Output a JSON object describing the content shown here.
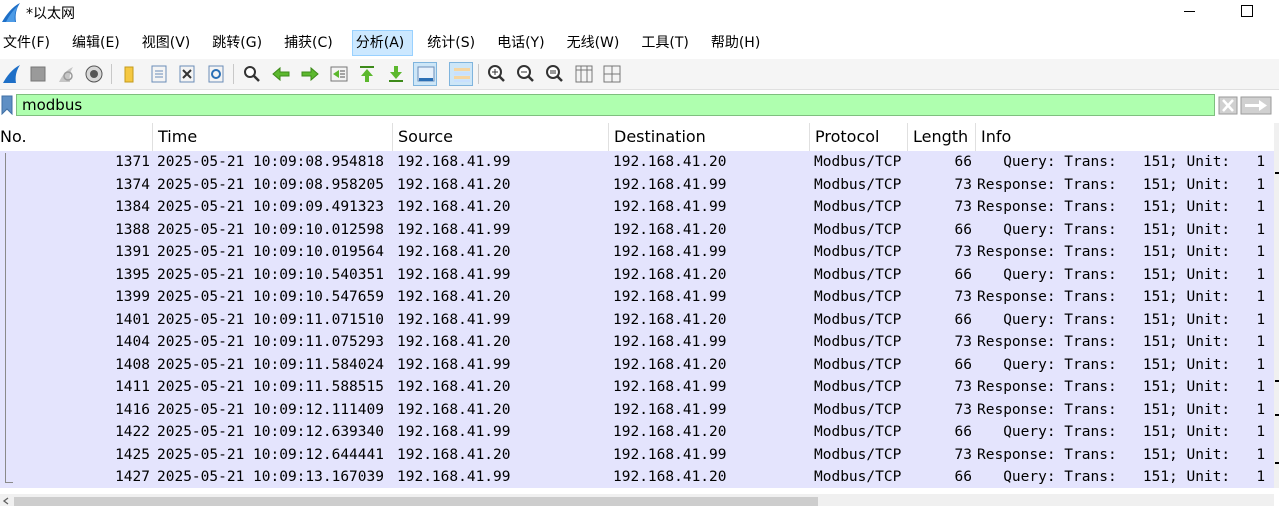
{
  "window": {
    "title": "*以太网"
  },
  "menu": [
    "文件(F)",
    "编辑(E)",
    "视图(V)",
    "跳转(G)",
    "捕获(C)",
    "分析(A)",
    "统计(S)",
    "电话(Y)",
    "无线(W)",
    "工具(T)",
    "帮助(H)"
  ],
  "menu_active_index": 5,
  "toolbar": {
    "icons": [
      "start-capture-icon",
      "stop-capture-icon",
      "restart-capture-icon",
      "capture-options-icon",
      "open-file-icon",
      "save-file-icon",
      "close-file-icon",
      "reload-file-icon",
      "find-packet-icon",
      "go-back-icon",
      "go-forward-icon",
      "go-to-packet-icon",
      "first-packet-icon",
      "last-packet-icon",
      "autoscroll-icon",
      "colorize-icon",
      "zoom-in-icon",
      "zoom-out-icon",
      "normal-size-icon",
      "resize-columns-icon",
      "layout-icon"
    ]
  },
  "filter": {
    "value": "modbus"
  },
  "columns": [
    "No.",
    "Time",
    "Source",
    "Destination",
    "Protocol",
    "Length",
    "Info"
  ],
  "packets": [
    {
      "no": "1371",
      "time": "2025-05-21 10:09:08.954818",
      "src": "192.168.41.99",
      "dst": "192.168.41.20",
      "proto": "Modbus/TCP",
      "len": "66",
      "info": "   Query: Trans:   151; Unit:   1"
    },
    {
      "no": "1374",
      "time": "2025-05-21 10:09:08.958205",
      "src": "192.168.41.20",
      "dst": "192.168.41.99",
      "proto": "Modbus/TCP",
      "len": "73",
      "info": "Response: Trans:   151; Unit:   1"
    },
    {
      "no": "1384",
      "time": "2025-05-21 10:09:09.491323",
      "src": "192.168.41.20",
      "dst": "192.168.41.99",
      "proto": "Modbus/TCP",
      "len": "73",
      "info": "Response: Trans:   151; Unit:   1"
    },
    {
      "no": "1388",
      "time": "2025-05-21 10:09:10.012598",
      "src": "192.168.41.99",
      "dst": "192.168.41.20",
      "proto": "Modbus/TCP",
      "len": "66",
      "info": "   Query: Trans:   151; Unit:   1"
    },
    {
      "no": "1391",
      "time": "2025-05-21 10:09:10.019564",
      "src": "192.168.41.20",
      "dst": "192.168.41.99",
      "proto": "Modbus/TCP",
      "len": "73",
      "info": "Response: Trans:   151; Unit:   1"
    },
    {
      "no": "1395",
      "time": "2025-05-21 10:09:10.540351",
      "src": "192.168.41.99",
      "dst": "192.168.41.20",
      "proto": "Modbus/TCP",
      "len": "66",
      "info": "   Query: Trans:   151; Unit:   1"
    },
    {
      "no": "1399",
      "time": "2025-05-21 10:09:10.547659",
      "src": "192.168.41.20",
      "dst": "192.168.41.99",
      "proto": "Modbus/TCP",
      "len": "73",
      "info": "Response: Trans:   151; Unit:   1"
    },
    {
      "no": "1401",
      "time": "2025-05-21 10:09:11.071510",
      "src": "192.168.41.99",
      "dst": "192.168.41.20",
      "proto": "Modbus/TCP",
      "len": "66",
      "info": "   Query: Trans:   151; Unit:   1"
    },
    {
      "no": "1404",
      "time": "2025-05-21 10:09:11.075293",
      "src": "192.168.41.20",
      "dst": "192.168.41.99",
      "proto": "Modbus/TCP",
      "len": "73",
      "info": "Response: Trans:   151; Unit:   1"
    },
    {
      "no": "1408",
      "time": "2025-05-21 10:09:11.584024",
      "src": "192.168.41.99",
      "dst": "192.168.41.20",
      "proto": "Modbus/TCP",
      "len": "66",
      "info": "   Query: Trans:   151; Unit:   1"
    },
    {
      "no": "1411",
      "time": "2025-05-21 10:09:11.588515",
      "src": "192.168.41.20",
      "dst": "192.168.41.99",
      "proto": "Modbus/TCP",
      "len": "73",
      "info": "Response: Trans:   151; Unit:   1"
    },
    {
      "no": "1416",
      "time": "2025-05-21 10:09:12.111409",
      "src": "192.168.41.20",
      "dst": "192.168.41.99",
      "proto": "Modbus/TCP",
      "len": "73",
      "info": "Response: Trans:   151; Unit:   1"
    },
    {
      "no": "1422",
      "time": "2025-05-21 10:09:12.639340",
      "src": "192.168.41.99",
      "dst": "192.168.41.20",
      "proto": "Modbus/TCP",
      "len": "66",
      "info": "   Query: Trans:   151; Unit:   1"
    },
    {
      "no": "1425",
      "time": "2025-05-21 10:09:12.644441",
      "src": "192.168.41.20",
      "dst": "192.168.41.99",
      "proto": "Modbus/TCP",
      "len": "73",
      "info": "Response: Trans:   151; Unit:   1"
    },
    {
      "no": "1427",
      "time": "2025-05-21 10:09:13.167039",
      "src": "192.168.41.99",
      "dst": "192.168.41.20",
      "proto": "Modbus/TCP",
      "len": "66",
      "info": "   Query: Trans:   151; Unit:   1"
    }
  ],
  "colors": {
    "row_bg": "#e4e4fd",
    "filter_valid_bg": "#afffaf",
    "menu_active_bg": "#cce8ff"
  }
}
